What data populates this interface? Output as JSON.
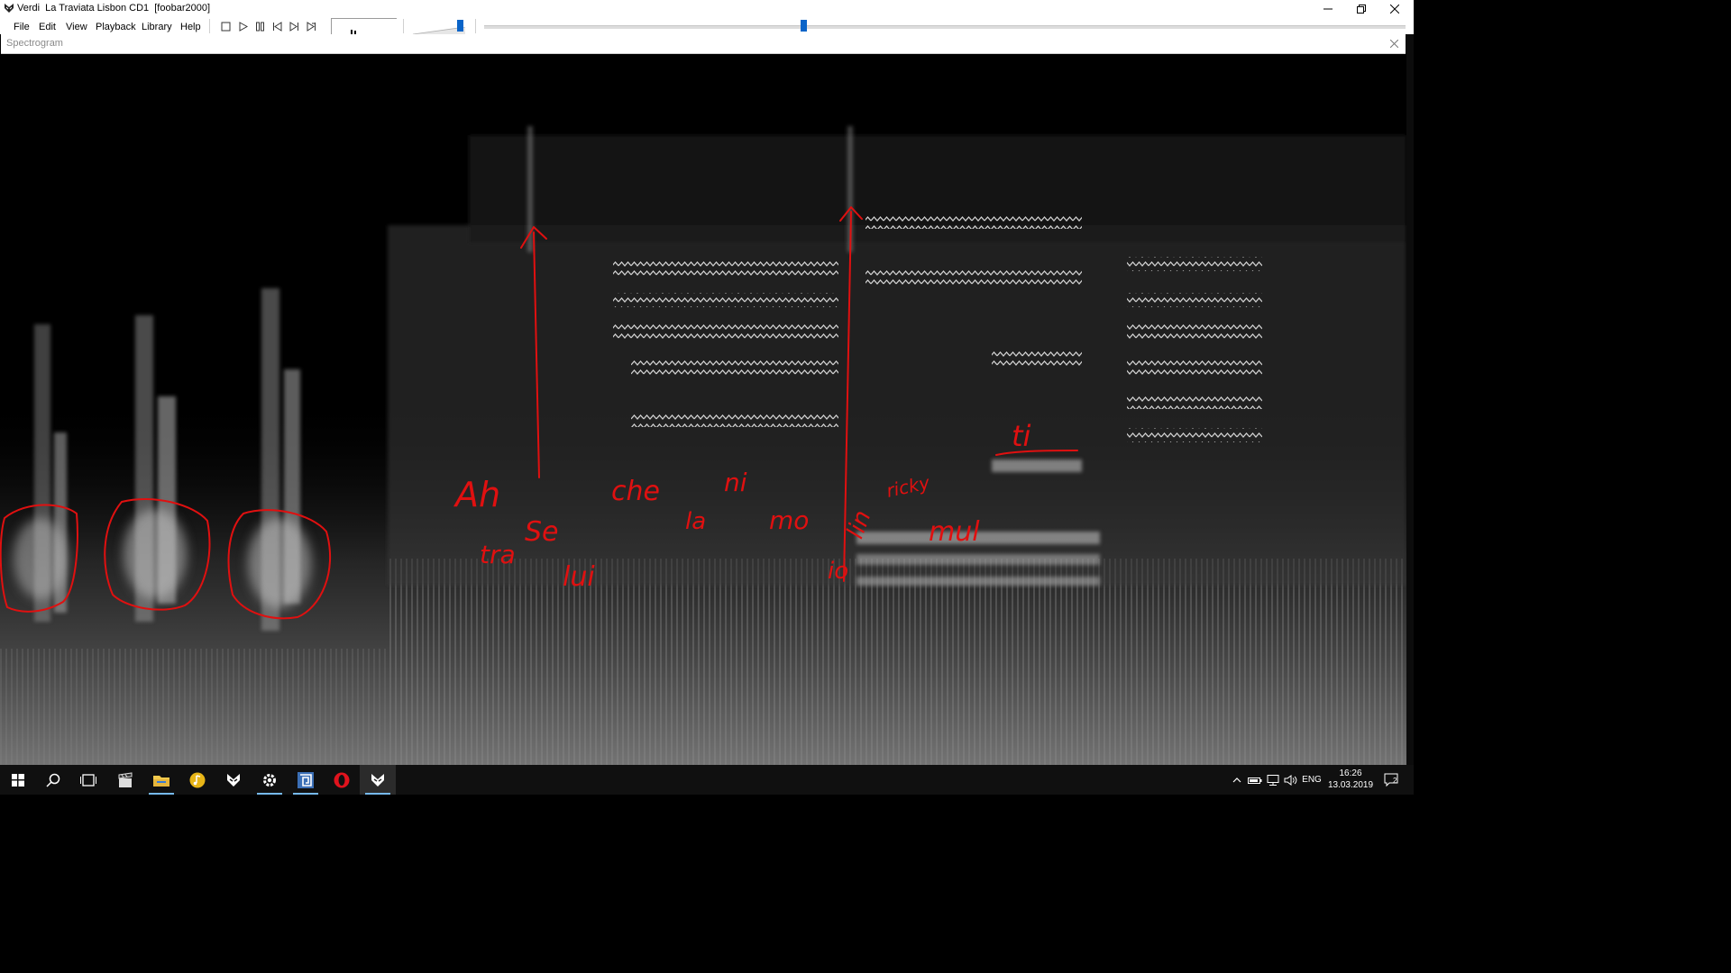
{
  "window": {
    "title": "Verdi  La Traviata Lisbon CD1  [foobar2000]",
    "controls": [
      "minimize-icon",
      "maximize-icon",
      "close-icon"
    ]
  },
  "menu": {
    "items": [
      "File",
      "Edit",
      "View",
      "Playback",
      "Library",
      "Help"
    ]
  },
  "toolbar": {
    "buttons": [
      "stop-icon",
      "play-icon",
      "pause-icon",
      "previous-icon",
      "next-icon",
      "random-icon"
    ],
    "volume_level": 0.9,
    "seek_position": 0.35
  },
  "panel": {
    "title": "Spectrogram"
  },
  "annotations": {
    "color": "#e01010",
    "words": [
      "Ah",
      "Se",
      "tra",
      "lui",
      "che",
      "la",
      "ni",
      "mo",
      "lin",
      "io",
      "ricky",
      "mul",
      "ti"
    ]
  },
  "taskbar": {
    "tray": {
      "language": "ENG",
      "time": "16:26",
      "date": "13.03.2019",
      "notification_count": "2"
    }
  },
  "colors": {
    "accent": "#0a64c8",
    "taskbar_bg": "#101010",
    "annotation": "#e01010"
  }
}
